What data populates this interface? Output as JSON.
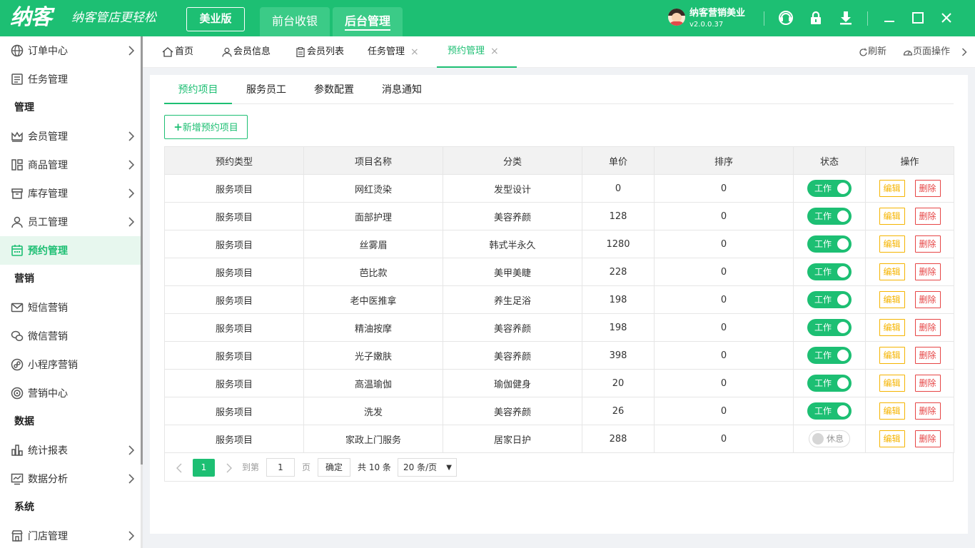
{
  "topbar": {
    "logo": "纳客",
    "slogan": "纳客管店更轻松",
    "edition": "美业版",
    "nav_front": "前台收银",
    "nav_back": "后台管理",
    "user_name": "纳客营销美业",
    "version": "v2.0.0.37",
    "brand_color": "#1dbf73"
  },
  "sidebar": {
    "items": [
      {
        "label": "订单中心",
        "icon": "globe-icon"
      },
      {
        "label": "任务管理",
        "icon": "task-icon"
      },
      {
        "section": "管理"
      },
      {
        "label": "会员管理",
        "icon": "crown-icon"
      },
      {
        "label": "商品管理",
        "icon": "goods-icon"
      },
      {
        "label": "库存管理",
        "icon": "box-icon"
      },
      {
        "label": "员工管理",
        "icon": "person-icon"
      },
      {
        "label": "预约管理",
        "icon": "calendar-icon",
        "active": true
      },
      {
        "section": "营销"
      },
      {
        "label": "短信营销",
        "icon": "mail-icon"
      },
      {
        "label": "微信营销",
        "icon": "wechat-icon"
      },
      {
        "label": "小程序营销",
        "icon": "miniapp-icon"
      },
      {
        "label": "营销中心",
        "icon": "target-icon"
      },
      {
        "section": "数据"
      },
      {
        "label": "统计报表",
        "icon": "bar-chart-icon"
      },
      {
        "label": "数据分析",
        "icon": "monitor-chart-icon"
      },
      {
        "section": "系统"
      },
      {
        "label": "门店管理",
        "icon": "store-icon"
      }
    ]
  },
  "tabs": {
    "items": [
      "首页",
      "会员信息",
      "会员列表",
      "任务管理",
      "预约管理"
    ],
    "refresh": "刷新",
    "page_ops": "页面操作"
  },
  "subtabs": [
    "预约项目",
    "服务员工",
    "参数配置",
    "消息通知"
  ],
  "add_button": "新增预约项目",
  "table": {
    "headers": [
      "预约类型",
      "项目名称",
      "分类",
      "单价",
      "排序",
      "状态",
      "操作"
    ],
    "rows": [
      {
        "type": "服务项目",
        "name": "网红烫染",
        "category": "发型设计",
        "price": "0",
        "sort": "0",
        "status": "工作",
        "on": true
      },
      {
        "type": "服务项目",
        "name": "面部护理",
        "category": "美容养颜",
        "price": "128",
        "sort": "0",
        "status": "工作",
        "on": true
      },
      {
        "type": "服务项目",
        "name": "丝雾眉",
        "category": "韩式半永久",
        "price": "1280",
        "sort": "0",
        "status": "工作",
        "on": true
      },
      {
        "type": "服务项目",
        "name": "芭比款",
        "category": "美甲美睫",
        "price": "228",
        "sort": "0",
        "status": "工作",
        "on": true
      },
      {
        "type": "服务项目",
        "name": "老中医推拿",
        "category": "养生足浴",
        "price": "198",
        "sort": "0",
        "status": "工作",
        "on": true
      },
      {
        "type": "服务项目",
        "name": "精油按摩",
        "category": "美容养颜",
        "price": "198",
        "sort": "0",
        "status": "工作",
        "on": true
      },
      {
        "type": "服务项目",
        "name": "光子嫩肤",
        "category": "美容养颜",
        "price": "398",
        "sort": "0",
        "status": "工作",
        "on": true
      },
      {
        "type": "服务项目",
        "name": "高温瑜伽",
        "category": "瑜伽健身",
        "price": "20",
        "sort": "0",
        "status": "工作",
        "on": true
      },
      {
        "type": "服务项目",
        "name": "洗发",
        "category": "美容养颜",
        "price": "26",
        "sort": "0",
        "status": "工作",
        "on": true
      },
      {
        "type": "服务项目",
        "name": "家政上门服务",
        "category": "居家日护",
        "price": "288",
        "sort": "0",
        "status": "休息",
        "on": false
      }
    ],
    "edit_label": "编辑",
    "delete_label": "删除"
  },
  "pager": {
    "current_page": "1",
    "goto_label": "到第",
    "goto_value": "1",
    "page_unit": "页",
    "confirm": "确定",
    "total": "共 10 条",
    "page_size": "20 条/页"
  }
}
